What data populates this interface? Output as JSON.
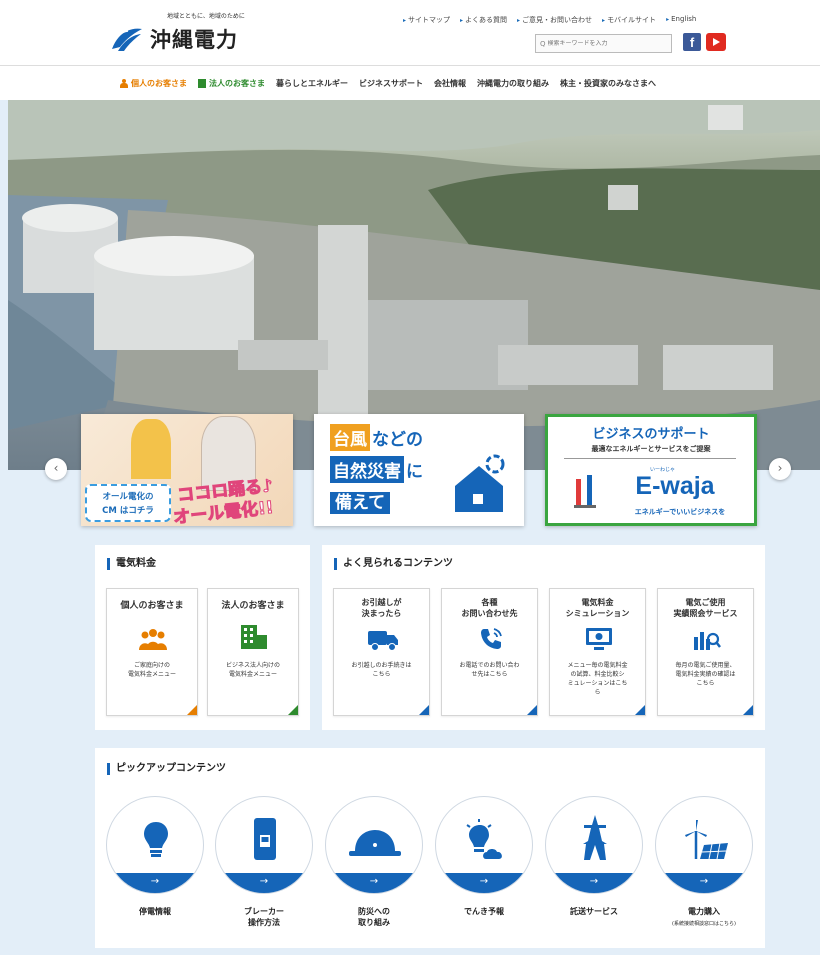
{
  "header": {
    "tagline": "地域とともに、地域のために",
    "logo_text": "沖縄電力",
    "utility_links": [
      "サイトマップ",
      "よくある質問",
      "ご意見・お問い合わせ",
      "モバイルサイト",
      "English"
    ],
    "search_placeholder": "検索キーワードを入力",
    "facebook_label": "f"
  },
  "nav": {
    "items": [
      "個人のお客さま",
      "法人のお客さま",
      "暮らしとエネルギー",
      "ビジネスサポート",
      "会社情報",
      "沖縄電力の取り組み",
      "株主・投資家のみなさまへ"
    ]
  },
  "carousel": {
    "prev": "‹",
    "next": "›",
    "banner1": {
      "cm_line1": "オール電化の",
      "cm_line2": "CM はコチラ",
      "headline1": "ココロ踊る♪",
      "headline2": "オール電化!!"
    },
    "banner2": {
      "w1": "台風",
      "w2": "などの",
      "w3": "自然災害",
      "w4": "に",
      "w5": "備えて"
    },
    "banner3": {
      "title": "ビジネスのサポート",
      "subtitle": "最適なエネルギーとサービスをご提案",
      "ruby": "いーわじゃ",
      "brand": "E-waja",
      "tagline": "エネルギーでいいビジネスを"
    }
  },
  "price": {
    "title": "電気料金",
    "cards": [
      {
        "title": "個人のお客さま",
        "desc": "ご家庭向けの\n電気料金メニュー"
      },
      {
        "title": "法人のお客さま",
        "desc": "ビジネス法人向けの\n電気料金メニュー"
      }
    ]
  },
  "popular": {
    "title": "よく見られるコンテンツ",
    "cards": [
      {
        "title": "お引越しが\n決まったら",
        "desc": "お引越しのお手続きは\nこちら"
      },
      {
        "title": "各種\nお問い合わせ先",
        "desc": "お電話でのお問い合わ\nせ先はこちら"
      },
      {
        "title": "電気料金\nシミュレーション",
        "desc": "メニュー毎の電気料金\nの試算、料金比較シ\nミュレーションはこち\nら"
      },
      {
        "title": "電気ご使用\n実績照会サービス",
        "desc": "毎月の電気ご使用量、\n電気料金実績の確認は\nこちら"
      }
    ]
  },
  "pickup": {
    "title": "ピックアップコンテンツ",
    "arrow": "→",
    "items": [
      {
        "label": "停電情報",
        "sub": ""
      },
      {
        "label": "ブレーカー\n操作方法",
        "sub": ""
      },
      {
        "label": "防災への\n取り組み",
        "sub": ""
      },
      {
        "label": "でんき予報",
        "sub": ""
      },
      {
        "label": "託送サービス",
        "sub": ""
      },
      {
        "label": "電力購入",
        "sub": "(系統接続相談窓口はこちら)"
      }
    ]
  },
  "colors": {
    "brand_blue": "#1565b8",
    "personal_orange": "#e67e00",
    "business_green": "#2e8b2e"
  }
}
